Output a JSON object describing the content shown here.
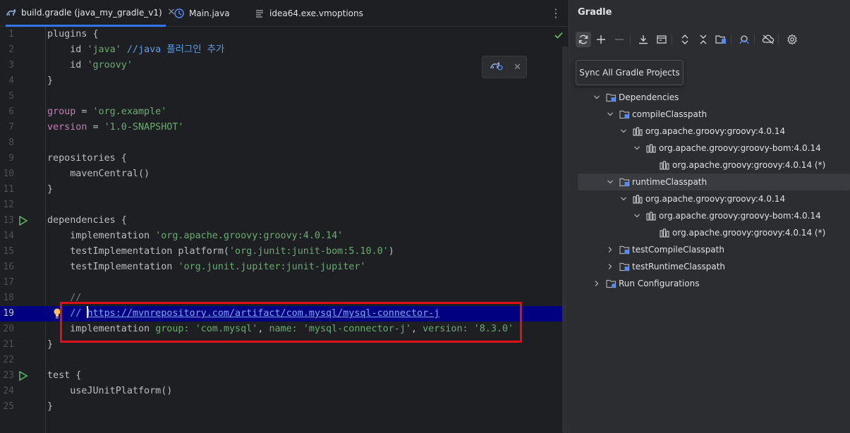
{
  "tabs": [
    {
      "label": "build.gradle (java_my_gradle_v1)",
      "icon": "gradle-file-icon",
      "active": true,
      "closable": true
    },
    {
      "label": "Main.java",
      "icon": "java-class-icon",
      "active": false
    },
    {
      "label": "idea64.exe.vmoptions",
      "icon": "text-file-icon",
      "active": false
    }
  ],
  "editor": {
    "current_line": 19,
    "lines": [
      {
        "n": "1",
        "tokens": [
          [
            "plugins {",
            "norm"
          ]
        ]
      },
      {
        "n": "2",
        "tokens": [
          [
            "    id ",
            "norm"
          ],
          [
            "'java'",
            "str"
          ],
          [
            " //java 플러그인 추가",
            "cmk"
          ]
        ]
      },
      {
        "n": "3",
        "tokens": [
          [
            "    id ",
            "norm"
          ],
          [
            "'groovy'",
            "str"
          ]
        ]
      },
      {
        "n": "4",
        "tokens": [
          [
            "}",
            "norm"
          ]
        ]
      },
      {
        "n": "5",
        "tokens": []
      },
      {
        "n": "6",
        "tokens": [
          [
            "group",
            "var"
          ],
          [
            " = ",
            "norm"
          ],
          [
            "'org.example'",
            "str"
          ]
        ]
      },
      {
        "n": "7",
        "tokens": [
          [
            "version",
            "var"
          ],
          [
            " = ",
            "norm"
          ],
          [
            "'1.0-SNAPSHOT'",
            "str"
          ]
        ]
      },
      {
        "n": "8",
        "tokens": []
      },
      {
        "n": "9",
        "tokens": [
          [
            "repositories {",
            "norm"
          ]
        ]
      },
      {
        "n": "10",
        "tokens": [
          [
            "    mavenCentral()",
            "norm"
          ]
        ]
      },
      {
        "n": "11",
        "tokens": [
          [
            "}",
            "norm"
          ]
        ]
      },
      {
        "n": "12",
        "tokens": []
      },
      {
        "n": "13",
        "tokens": [
          [
            "dependencies {",
            "norm"
          ]
        ],
        "run": true
      },
      {
        "n": "14",
        "tokens": [
          [
            "    implementation ",
            "norm"
          ],
          [
            "'org.apache.groovy:groovy:4.0.14'",
            "str"
          ]
        ]
      },
      {
        "n": "15",
        "tokens": [
          [
            "    testImplementation platform(",
            "norm"
          ],
          [
            "'org.junit:junit-bom:5.10.0'",
            "str"
          ],
          [
            ")",
            "norm"
          ]
        ]
      },
      {
        "n": "16",
        "tokens": [
          [
            "    testImplementation ",
            "norm"
          ],
          [
            "'org.junit.jupiter:junit-jupiter'",
            "str"
          ]
        ]
      },
      {
        "n": "17",
        "tokens": []
      },
      {
        "n": "18",
        "tokens": [
          [
            "    //",
            "cm"
          ]
        ]
      },
      {
        "n": "19",
        "tokens": [
          [
            "    // ",
            "cmk"
          ],
          [
            "|",
            "caret"
          ],
          [
            "https://mvnrepository.com/artifact/com.mysql/mysql-connector-j",
            "link"
          ]
        ],
        "bulb": true
      },
      {
        "n": "20",
        "tokens": [
          [
            "    implementation ",
            "norm"
          ],
          [
            "group: ",
            "str"
          ],
          [
            "'com.mysql'",
            "str"
          ],
          [
            ", ",
            "norm"
          ],
          [
            "name: ",
            "str"
          ],
          [
            "'mysql-connector-j'",
            "str"
          ],
          [
            ", ",
            "norm"
          ],
          [
            "version: ",
            "str"
          ],
          [
            "'8.3.0'",
            "str"
          ]
        ]
      },
      {
        "n": "21",
        "tokens": [
          [
            "}",
            "norm"
          ]
        ]
      },
      {
        "n": "22",
        "tokens": []
      },
      {
        "n": "23",
        "tokens": [
          [
            "test {",
            "norm"
          ]
        ],
        "run": true
      },
      {
        "n": "24",
        "tokens": [
          [
            "    useJUnitPlatform()",
            "norm"
          ]
        ]
      },
      {
        "n": "25",
        "tokens": [
          [
            "}",
            "norm"
          ]
        ]
      }
    ]
  },
  "colors": {
    "highlight_box": "#e0101b",
    "current_line_bg": "#000080",
    "string": "#6aab73",
    "accent": "#3574f0"
  },
  "gradle": {
    "title": "Gradle",
    "toolbar": [
      {
        "icon": "sync-icon",
        "hover": true
      },
      {
        "icon": "plus-icon"
      },
      {
        "icon": "minus-icon"
      },
      {
        "icon": "download-icon",
        "sep_before": true
      },
      {
        "icon": "build-scripts-icon"
      },
      {
        "icon": "expand-all-icon",
        "sep_before": true
      },
      {
        "icon": "collapse-all-icon"
      },
      {
        "icon": "dependency-analyzer-icon"
      },
      {
        "icon": "toggle-offline-icon",
        "sep_before": true
      },
      {
        "icon": "cloud-off-icon",
        "sep_before": true
      },
      {
        "icon": "settings-icon",
        "sep_before": true
      }
    ],
    "tooltip": "Sync All Gradle Projects",
    "tree": [
      {
        "label": "Dependencies",
        "depth": 1,
        "chevron": "down",
        "icon": "folder-icon"
      },
      {
        "label": "compileClasspath",
        "depth": 2,
        "chevron": "down",
        "icon": "folder-icon"
      },
      {
        "label": "org.apache.groovy:groovy:4.0.14",
        "depth": 3,
        "chevron": "down",
        "icon": "library-icon"
      },
      {
        "label": "org.apache.groovy:groovy-bom:4.0.14",
        "depth": 4,
        "chevron": "down",
        "icon": "library-icon"
      },
      {
        "label": "org.apache.groovy:groovy:4.0.14 (*)",
        "depth": 5,
        "chevron": "none",
        "icon": "library-icon"
      },
      {
        "label": "runtimeClasspath",
        "depth": 2,
        "chevron": "down",
        "icon": "folder-icon",
        "selected": true
      },
      {
        "label": "org.apache.groovy:groovy:4.0.14",
        "depth": 3,
        "chevron": "down",
        "icon": "library-icon"
      },
      {
        "label": "org.apache.groovy:groovy-bom:4.0.14",
        "depth": 4,
        "chevron": "down",
        "icon": "library-icon"
      },
      {
        "label": "org.apache.groovy:groovy:4.0.14 (*)",
        "depth": 5,
        "chevron": "none",
        "icon": "library-icon"
      },
      {
        "label": "testCompileClasspath",
        "depth": 2,
        "chevron": "right",
        "icon": "folder-icon"
      },
      {
        "label": "testRuntimeClasspath",
        "depth": 2,
        "chevron": "right",
        "icon": "folder-icon"
      },
      {
        "label": "Run Configurations",
        "depth": 1,
        "chevron": "right",
        "icon": "run-config-icon"
      }
    ]
  }
}
